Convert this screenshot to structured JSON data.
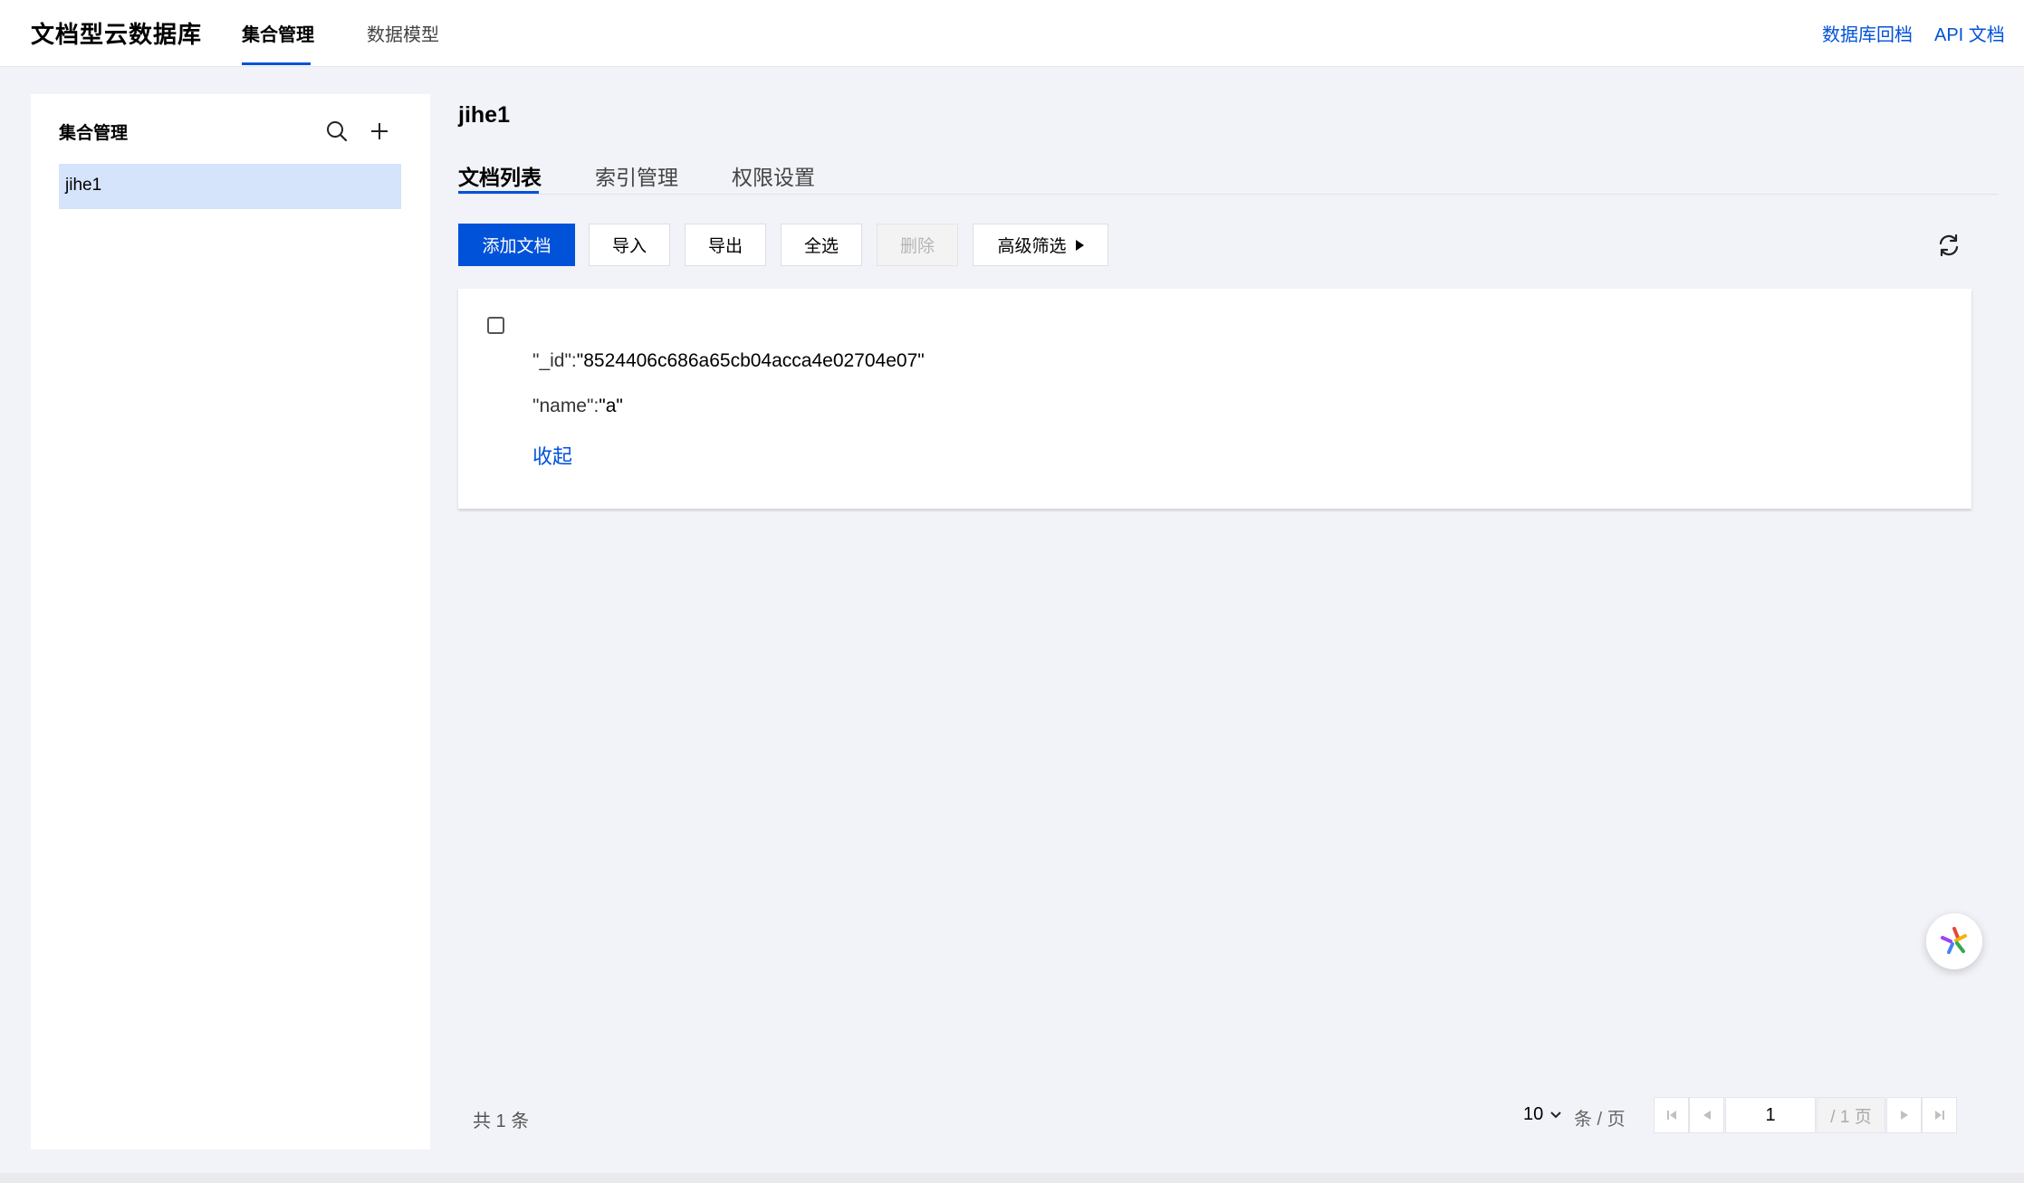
{
  "app": {
    "title": "文档型云数据库",
    "nav_tabs": [
      {
        "label": "集合管理",
        "active": true
      },
      {
        "label": "数据模型",
        "active": false
      }
    ],
    "links": [
      "数据库回档",
      "API 文档"
    ]
  },
  "sidebar": {
    "title": "集合管理",
    "icons": [
      "search-icon",
      "plus-icon"
    ],
    "items": [
      {
        "label": "jihe1",
        "selected": true
      }
    ]
  },
  "main": {
    "collection_title": "jihe1",
    "tabs": [
      {
        "label": "文档列表",
        "active": true
      },
      {
        "label": "索引管理",
        "active": false
      },
      {
        "label": "权限设置",
        "active": false
      }
    ],
    "toolbar": {
      "add": "添加文档",
      "import": "导入",
      "export": "导出",
      "select_all": "全选",
      "delete": "删除",
      "filter": "高级筛选"
    },
    "document": {
      "id_key": "\"_id\":",
      "id_value": "\"8524406c686a65cb04acca4e02704e07\"",
      "name_key": "\"name\":",
      "name_value": "\"a\"",
      "collapse": "收起"
    }
  },
  "pagination": {
    "total": "共 1 条",
    "page_size": "10",
    "per_page_label": "条 / 页",
    "current_page": "1",
    "total_pages": "/ 1 页"
  },
  "colors": {
    "accent": "#0052d9",
    "selected_bg": "#d5e3fb",
    "page_bg": "#f2f3f8"
  }
}
